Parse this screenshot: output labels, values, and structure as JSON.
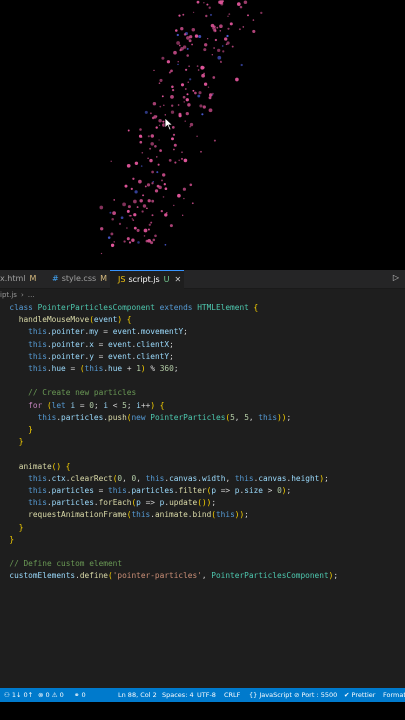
{
  "tabs": [
    {
      "label": "x.html",
      "modified": "M",
      "icon": "html-icon",
      "active": false
    },
    {
      "label": "style.css",
      "modified": "M",
      "icon": "css-icon",
      "active": false
    },
    {
      "label": "script.js",
      "modified": "U",
      "icon": "js-icon",
      "active": true
    }
  ],
  "tab_close": "✕",
  "run_icon": "▷",
  "breadcrumb": [
    "ipt.js",
    "›",
    "…"
  ],
  "code_lines": [
    "  class PointerParticlesComponent extends HTMLElement {",
    "    handleMouseMove(event) {",
    "      this.pointer.my = event.movementY;",
    "      this.pointer.x = event.clientX;",
    "      this.pointer.y = event.clientY;",
    "      this.hue = (this.hue + 1) % 360;",
    "",
    "      // Create new particles",
    "      for (let i = 0; i < 5; i++) {",
    "        this.particles.push(new PointerParticles(5, 5, this));",
    "      }",
    "    }",
    "",
    "    animate() {",
    "      this.ctx.clearRect(0, 0, this.canvas.width, this.canvas.height);",
    "      this.particles = this.particles.filter(p => p.size > 0);",
    "      this.particles.forEach(p => p.update());",
    "      requestAnimationFrame(this.animate.bind(this));",
    "    }",
    "  }",
    "",
    "  // Define custom element",
    "  customElements.define('pointer-particles', PointerParticlesComponent);"
  ],
  "statusbar": {
    "branch": "⚇ 1↓ 0↑",
    "problems": "⊗ 0 ⚠ 0",
    "ports": "⚭ 0",
    "position": "Ln 88, Col 2",
    "spaces": "Spaces: 4",
    "encoding": "UTF-8",
    "eol": "CRLF",
    "language": "{} JavaScript",
    "port": "⊘ Port : 5500",
    "prettier": "✔ Prettier",
    "format": "Format"
  },
  "colors": {
    "particle": "#e0559a",
    "particle_alt": "#4a5bd6",
    "accent": "#007acc"
  }
}
